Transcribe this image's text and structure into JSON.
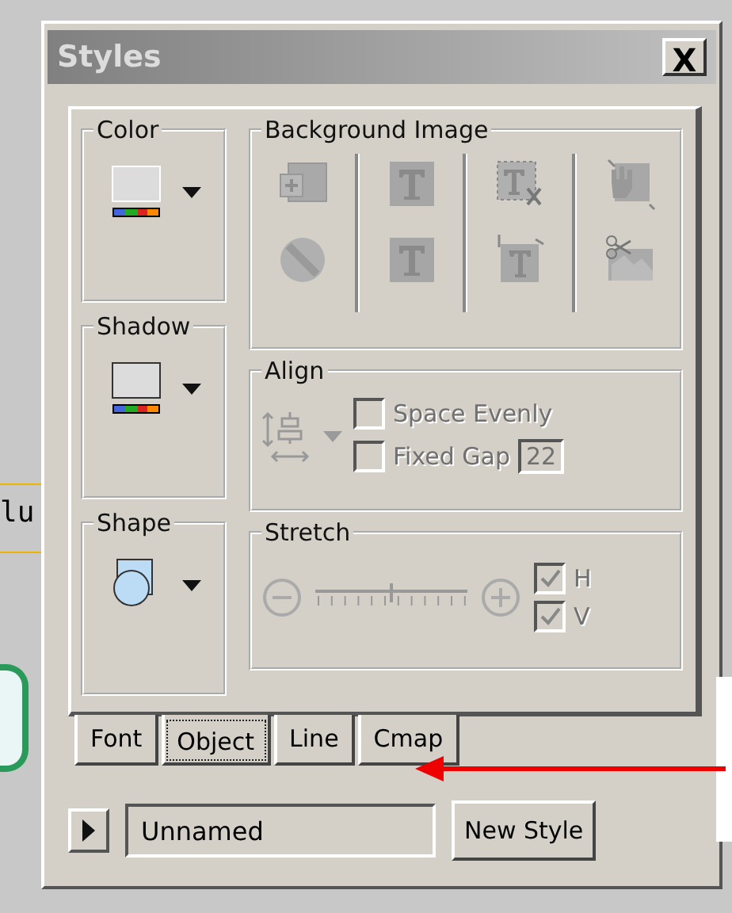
{
  "backdrop": {
    "text": "lu"
  },
  "window": {
    "title": "Styles",
    "close": "X"
  },
  "color": {
    "label": "Color"
  },
  "shadow": {
    "label": "Shadow"
  },
  "shape": {
    "label": "Shape"
  },
  "background_image": {
    "label": "Background Image",
    "buttons": [
      {
        "kind": "add",
        "disabled": true
      },
      {
        "kind": "none",
        "disabled": true
      },
      {
        "kind": "text",
        "disabled": true
      },
      {
        "kind": "text",
        "disabled": true
      },
      {
        "kind": "textcut",
        "disabled": true
      },
      {
        "kind": "textresize",
        "disabled": true
      },
      {
        "kind": "hand",
        "disabled": true
      },
      {
        "kind": "scissors",
        "disabled": true
      }
    ]
  },
  "align": {
    "label": "Align",
    "disabled": true,
    "options": [
      {
        "label": "Space Evenly",
        "checked": false
      },
      {
        "label": "Fixed Gap",
        "checked": false
      }
    ],
    "gap": "22"
  },
  "stretch": {
    "label": "Stretch",
    "disabled": true,
    "level": 0.5,
    "options": [
      {
        "label": "H",
        "checked": true
      },
      {
        "label": "V",
        "checked": true
      }
    ]
  },
  "tabs": [
    {
      "label": "Font",
      "selected": false
    },
    {
      "label": "Object",
      "selected": true
    },
    {
      "label": "Line",
      "selected": false
    },
    {
      "label": "Cmap",
      "selected": false
    }
  ],
  "style_name": {
    "value": "Unnamed"
  },
  "new_style_button": "New Style"
}
